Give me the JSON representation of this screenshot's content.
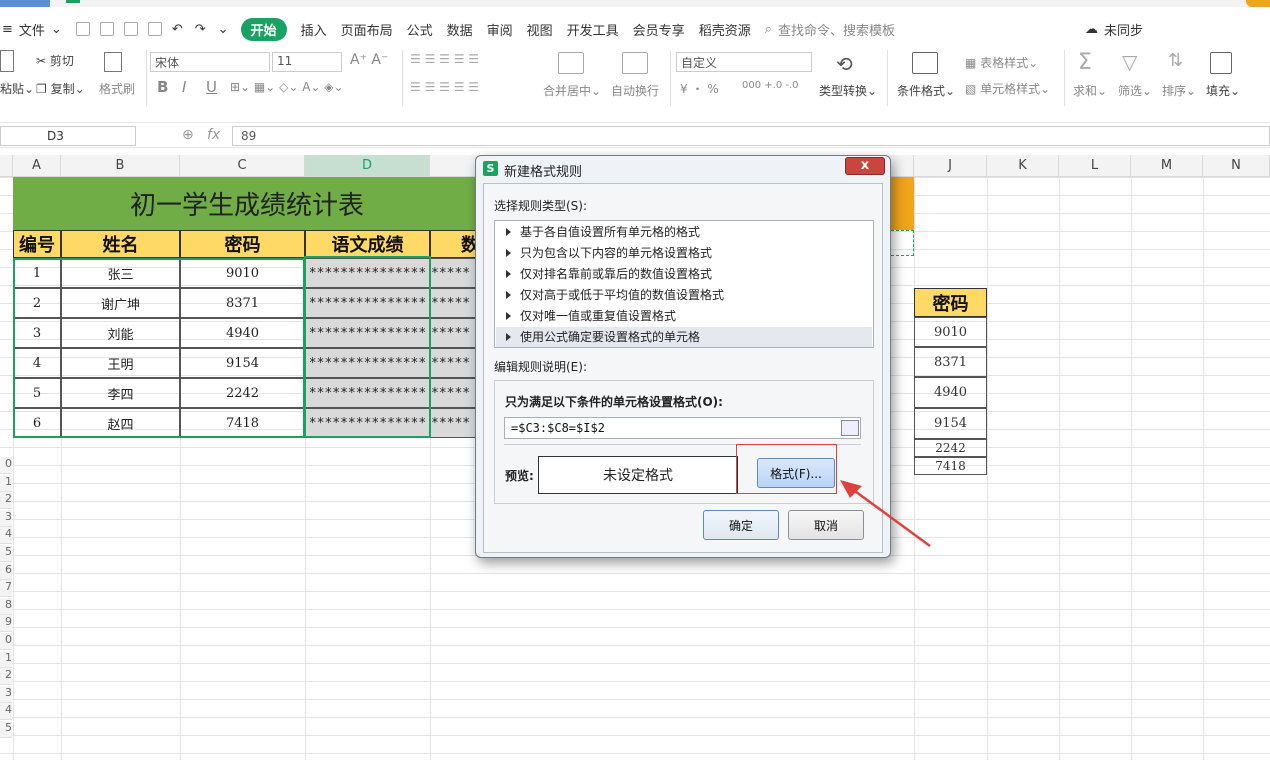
{
  "menu": {
    "file": "文件",
    "tabs": [
      "开始",
      "插入",
      "页面布局",
      "公式",
      "数据",
      "审阅",
      "视图",
      "开发工具",
      "会员专享",
      "稻壳资源"
    ],
    "search": "查找命令、搜索模板",
    "sync": "未同步"
  },
  "ribbon": {
    "paste": "粘贴",
    "cut": "剪切",
    "copy": "复制",
    "format_painter": "格式刷",
    "font": "宋体",
    "size": "11",
    "bold": "B",
    "italic": "I",
    "underline": "U",
    "merge": "合并居中",
    "wrap": "自动换行",
    "numfmt": "自定义",
    "pct": "¥ ・ %",
    "dec": "000 +.0 -.0",
    "convert": "类型转换",
    "cond": "条件格式",
    "table_style": "表格样式",
    "cell_style": "单元格样式",
    "sum": "求和",
    "filter": "筛选",
    "sort": "排序",
    "fill": "填充"
  },
  "formula_bar": {
    "cell": "D3",
    "fx": "fx",
    "value": "89"
  },
  "columns": [
    {
      "id": "A"
    },
    {
      "id": "B"
    },
    {
      "id": "C"
    },
    {
      "id": "D"
    },
    {
      "id": "J"
    },
    {
      "id": "K"
    },
    {
      "id": "L"
    },
    {
      "id": "M"
    },
    {
      "id": "N"
    }
  ],
  "sheet": {
    "title": "初一学生成绩统计表",
    "headers": [
      "编号",
      "姓名",
      "密码",
      "语文成绩",
      "数"
    ],
    "rows": [
      {
        "no": "1",
        "name": "张三",
        "pwd": "9010",
        "mask": "***************",
        "mask2": "*****"
      },
      {
        "no": "2",
        "name": "谢广坤",
        "pwd": "8371",
        "mask": "***************",
        "mask2": "*****"
      },
      {
        "no": "3",
        "name": "刘能",
        "pwd": "4940",
        "mask": "***************",
        "mask2": "*****"
      },
      {
        "no": "4",
        "name": "王明",
        "pwd": "9154",
        "mask": "***************",
        "mask2": "*****"
      },
      {
        "no": "5",
        "name": "李四",
        "pwd": "2242",
        "mask": "***************",
        "mask2": "*****"
      },
      {
        "no": "6",
        "name": "赵四",
        "pwd": "7418",
        "mask": "***************",
        "mask2": "*****"
      }
    ],
    "j_header": "密码",
    "j_values": [
      "9010",
      "8371",
      "4940",
      "9154",
      "2242",
      "7418"
    ],
    "row_numbers": [
      "0",
      "1",
      "2",
      "3",
      "4",
      "5",
      "6",
      "7",
      "8",
      "9",
      "0",
      "1",
      "2",
      "3",
      "4",
      "5"
    ]
  },
  "dialog": {
    "title": "新建格式规则",
    "select_label": "选择规则类型(S):",
    "rules": [
      "基于各自值设置所有单元格的格式",
      "只为包含以下内容的单元格设置格式",
      "仅对排名靠前或靠后的数值设置格式",
      "仅对高于或低于平均值的数值设置格式",
      "仅对唯一值或重复值设置格式",
      "使用公式确定要设置格式的单元格"
    ],
    "edit_label": "编辑规则说明(E):",
    "condition_label": "只为满足以下条件的单元格设置格式(O):",
    "formula": "=$C3:$C8=$I$2",
    "preview_label": "预览:",
    "preview_text": "未设定格式",
    "format_button": "格式(F)...",
    "ok": "确定",
    "cancel": "取消",
    "close": "x"
  },
  "colors": {
    "accent": "#1aa260",
    "title_bg": "#70ad47",
    "header_bg": "#ffd966",
    "highlight": "#e0413a"
  }
}
